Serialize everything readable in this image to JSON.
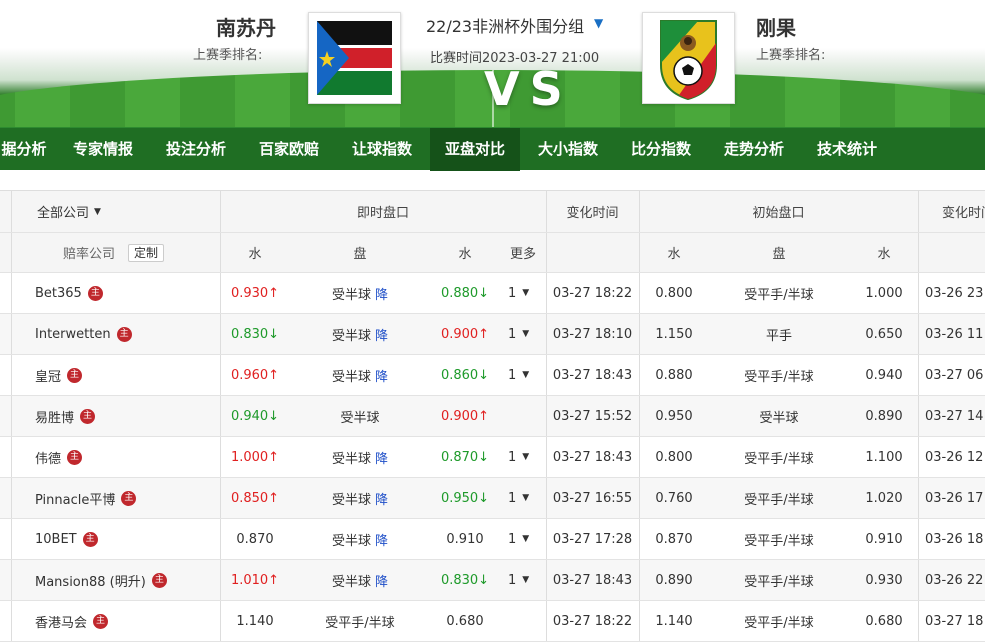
{
  "header": {
    "home_team": "南苏丹",
    "home_rank_label": "上赛季排名:",
    "away_team": "刚果",
    "away_rank_label": "上赛季排名:",
    "match_title": "22/23非洲杯外围分组",
    "match_time": "比赛时间2023-03-27 21:00",
    "vs_text": "VS"
  },
  "nav": {
    "items": [
      "据分析",
      "专家情报",
      "投注分析",
      "百家欧赔",
      "让球指数",
      "亚盘对比",
      "大小指数",
      "比分指数",
      "走势分析",
      "技术统计"
    ],
    "active": "亚盘对比"
  },
  "table": {
    "company_filter": "全部公司",
    "company_label": "赔率公司",
    "custom_button": "定制",
    "live_group": "即时盘口",
    "change_time": "变化时间",
    "initial_group": "初始盘口",
    "change_time2": "变化时间",
    "col_water1": "水",
    "col_handicap": "盘",
    "col_water2": "水",
    "col_more": "更多",
    "col_iwater1": "水",
    "col_ihandicap": "盘",
    "col_iwater2": "水",
    "company_icon_char": "主",
    "drop_label": "降",
    "rows": [
      {
        "company": "Bet365",
        "w1": "0.930↑",
        "w1c": "red",
        "hcp": "受半球",
        "drop": true,
        "w2": "0.880↓",
        "w2c": "green",
        "more": "1",
        "time": "03-27 18:22",
        "iw1": "0.800",
        "ihcp": "受平手/半球",
        "iw2": "1.000",
        "itime": "03-26 23"
      },
      {
        "company": "Interwetten",
        "w1": "0.830↓",
        "w1c": "green",
        "hcp": "受半球",
        "drop": true,
        "w2": "0.900↑",
        "w2c": "red",
        "more": "1",
        "time": "03-27 18:10",
        "iw1": "1.150",
        "ihcp": "平手",
        "iw2": "0.650",
        "itime": "03-26 11"
      },
      {
        "company": "皇冠",
        "w1": "0.960↑",
        "w1c": "red",
        "hcp": "受半球",
        "drop": true,
        "w2": "0.860↓",
        "w2c": "green",
        "more": "1",
        "time": "03-27 18:43",
        "iw1": "0.880",
        "ihcp": "受平手/半球",
        "iw2": "0.940",
        "itime": "03-27 06"
      },
      {
        "company": "易胜博",
        "w1": "0.940↓",
        "w1c": "green",
        "hcp": "受半球",
        "drop": false,
        "w2": "0.900↑",
        "w2c": "red",
        "more": "",
        "time": "03-27 15:52",
        "iw1": "0.950",
        "ihcp": "受半球",
        "iw2": "0.890",
        "itime": "03-27 14"
      },
      {
        "company": "伟德",
        "w1": "1.000↑",
        "w1c": "red",
        "hcp": "受半球",
        "drop": true,
        "w2": "0.870↓",
        "w2c": "green",
        "more": "1",
        "time": "03-27 18:43",
        "iw1": "0.800",
        "ihcp": "受平手/半球",
        "iw2": "1.100",
        "itime": "03-26 12"
      },
      {
        "company": "Pinnacle平博",
        "w1": "0.850↑",
        "w1c": "red",
        "hcp": "受半球",
        "drop": true,
        "w2": "0.950↓",
        "w2c": "green",
        "more": "1",
        "time": "03-27 16:55",
        "iw1": "0.760",
        "ihcp": "受平手/半球",
        "iw2": "1.020",
        "itime": "03-26 17"
      },
      {
        "company": "10BET",
        "w1": "0.870",
        "w1c": "num",
        "hcp": "受半球",
        "drop": true,
        "w2": "0.910",
        "w2c": "num",
        "more": "1",
        "time": "03-27 17:28",
        "iw1": "0.870",
        "ihcp": "受平手/半球",
        "iw2": "0.910",
        "itime": "03-26 18"
      },
      {
        "company": "Mansion88 (明升)",
        "w1": "1.010↑",
        "w1c": "red",
        "hcp": "受半球",
        "drop": true,
        "w2": "0.830↓",
        "w2c": "green",
        "more": "1",
        "time": "03-27 18:43",
        "iw1": "0.890",
        "ihcp": "受平手/半球",
        "iw2": "0.930",
        "itime": "03-26 22"
      },
      {
        "company": "香港马会",
        "w1": "1.140",
        "w1c": "num",
        "hcp": "受平手/半球",
        "drop": false,
        "w2": "0.680",
        "w2c": "num",
        "more": "",
        "time": "03-27 18:22",
        "iw1": "1.140",
        "ihcp": "受平手/半球",
        "iw2": "0.680",
        "itime": "03-27 18"
      }
    ]
  }
}
